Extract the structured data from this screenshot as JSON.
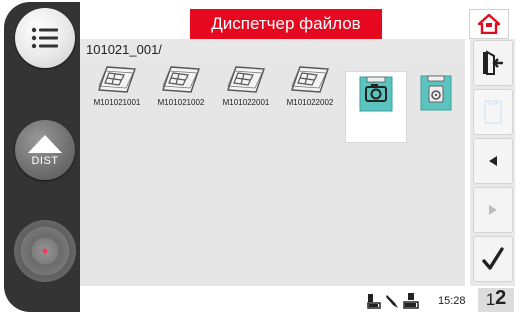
{
  "header": {
    "title": "Диспетчер файлов"
  },
  "path": "101021_001/",
  "left_rail": {
    "dist_label": "DIST"
  },
  "files": [
    {
      "name": "M101021001",
      "type": "image"
    },
    {
      "name": "M101021002",
      "type": "image"
    },
    {
      "name": "M101022001",
      "type": "image"
    },
    {
      "name": "M101022002",
      "type": "image"
    },
    {
      "name": "",
      "type": "camera-folder",
      "selected": true
    },
    {
      "name": "",
      "type": "disto-folder"
    }
  ],
  "status": {
    "time": "15:28"
  },
  "page_indicator": {
    "small": "1",
    "big": "2"
  },
  "colors": {
    "accent": "#e5081f",
    "rail": "#343434",
    "folder": "#5cc4c0"
  }
}
